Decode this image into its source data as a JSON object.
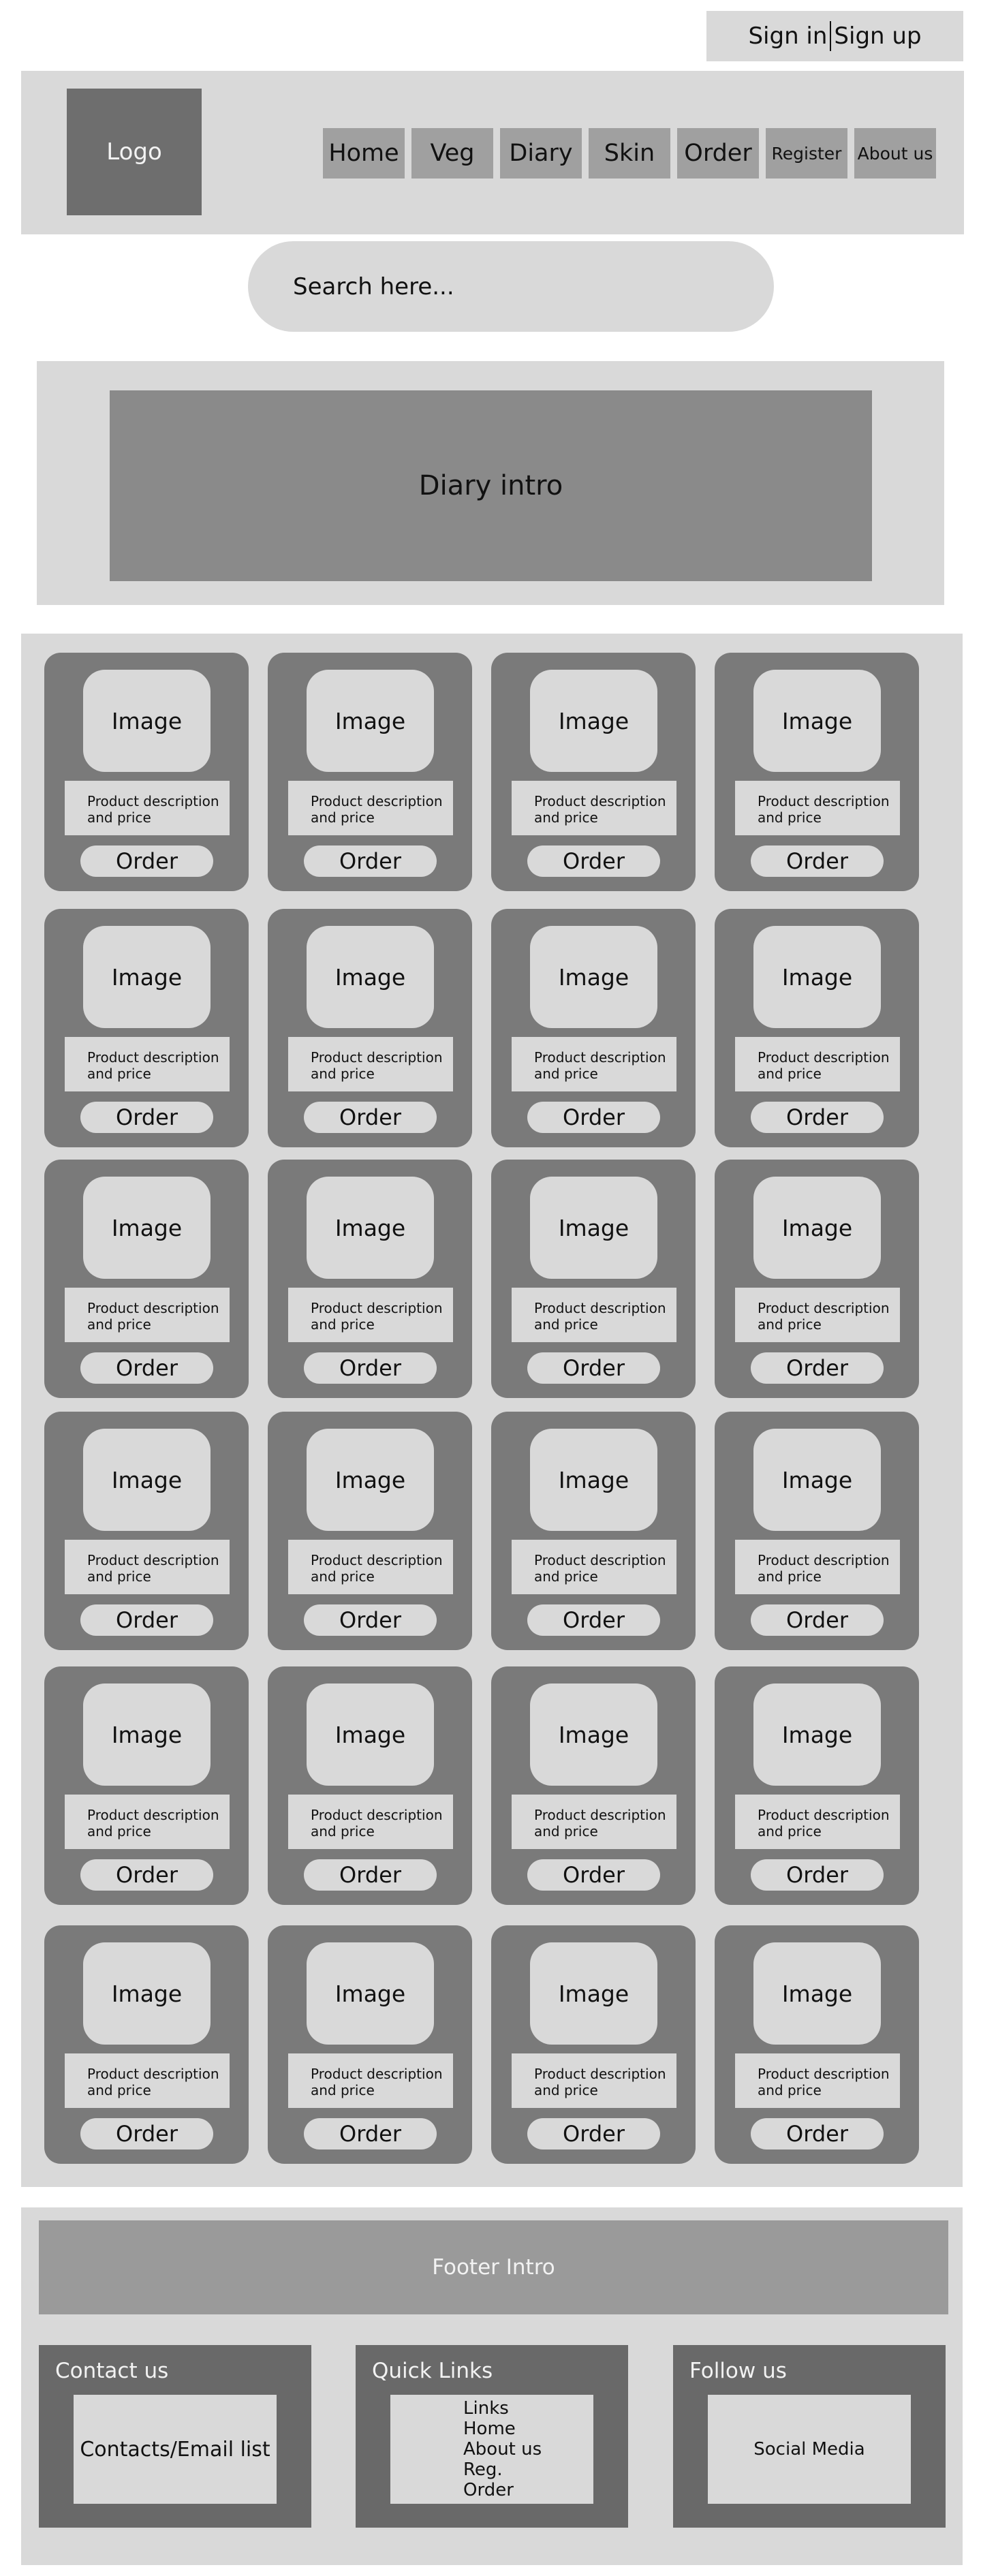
{
  "auth": {
    "sign_in": "Sign in",
    "sign_up": "Sign up"
  },
  "header": {
    "logo": "Logo",
    "nav": [
      "Home",
      "Veg",
      "Diary",
      "Skin",
      "Order",
      "Register",
      "About us"
    ]
  },
  "search": {
    "placeholder": "Search here..."
  },
  "intro": {
    "text": "Diary intro"
  },
  "products": {
    "image_label": "Image",
    "desc_line1": "Product description",
    "desc_line2": "and price",
    "order_label": "Order",
    "rows": 6,
    "cols": 4
  },
  "footer": {
    "intro": "Footer Intro",
    "contact_title": "Contact us",
    "contact_box": "Contacts/Email list",
    "links_title": "Quick Links",
    "links": [
      "Links",
      "Home",
      "About us",
      "Reg.",
      "Order"
    ],
    "follow_title": "Follow us",
    "follow_box": "Social Media"
  }
}
